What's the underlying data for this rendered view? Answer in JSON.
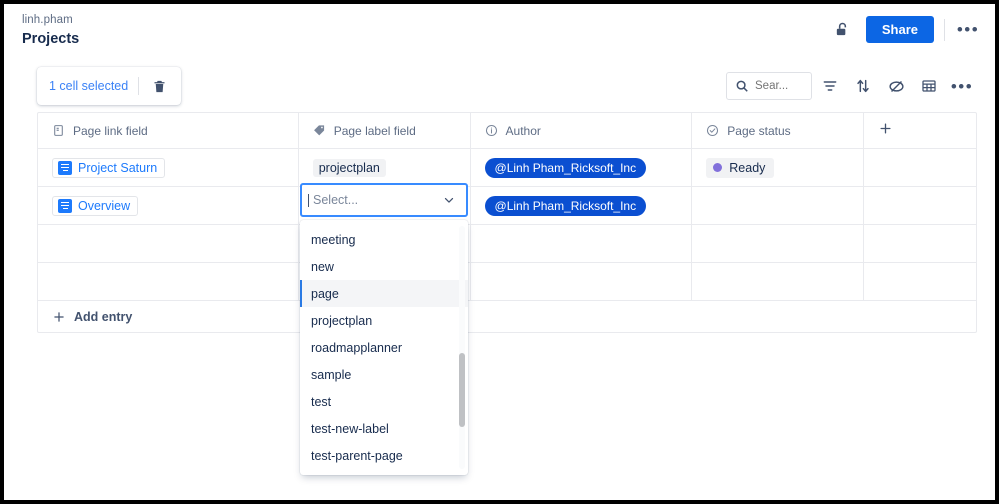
{
  "header": {
    "breadcrumb": "linh.pham",
    "title": "Projects",
    "lock_icon": "unlocked-padlock-icon",
    "share_label": "Share",
    "more_label": "•••"
  },
  "selection_toolbar": {
    "label": "1 cell selected",
    "delete_icon": "trash-icon"
  },
  "table_toolbar": {
    "search_placeholder": "Sear...",
    "search_value": "",
    "search_icon": "search-icon",
    "filter_icon": "filter-icon",
    "sort_icon": "sort-icon",
    "hide_icon": "eye-off-icon",
    "layout_icon": "table-layout-icon",
    "more_icon": "more-options-icon"
  },
  "table": {
    "columns": [
      {
        "label": "Page link field",
        "icon": "page-icon"
      },
      {
        "label": "Page label field",
        "icon": "tag-icon"
      },
      {
        "label": "Author",
        "icon": "info-circle-icon"
      },
      {
        "label": "Page status",
        "icon": "check-circle-icon"
      },
      {
        "label": "",
        "icon": "plus-icon"
      }
    ],
    "rows": [
      {
        "page_link": "Project Saturn",
        "page_label": "projectplan",
        "author": "@Linh Pham_Ricksoft_Inc",
        "status": "Ready"
      },
      {
        "page_link": "Overview",
        "page_label": "",
        "author": "@Linh Pham_Ricksoft_Inc",
        "status": ""
      },
      {
        "page_link": "",
        "page_label": "",
        "author": "",
        "status": ""
      },
      {
        "page_link": "",
        "page_label": "",
        "author": "",
        "status": ""
      }
    ],
    "add_entry_label": "Add entry"
  },
  "select": {
    "placeholder": "Select...",
    "value": "",
    "caret_icon": "chevron-down-icon",
    "highlighted": "page",
    "options": [
      "meeting",
      "new",
      "page",
      "projectplan",
      "roadmapplanner",
      "sample",
      "test",
      "test-new-label",
      "test-parent-page"
    ]
  },
  "colors": {
    "brand_blue": "#0c66e4",
    "link_blue": "#1d7afc",
    "author_pill": "#0b4fd1",
    "status_purple": "#8270db",
    "focus_border": "#388bff"
  }
}
